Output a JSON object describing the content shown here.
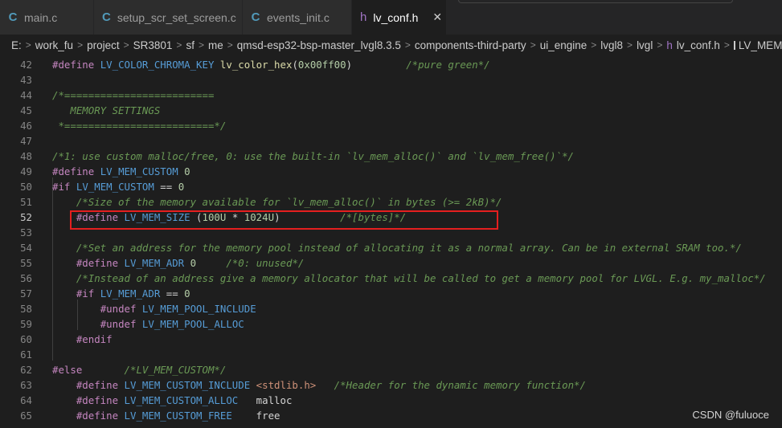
{
  "tabs": [
    {
      "icon": "C",
      "label": "main.c"
    },
    {
      "icon": "C",
      "label": "setup_scr_set_screen.c"
    },
    {
      "icon": "C",
      "label": "events_init.c"
    },
    {
      "icon": "h",
      "label": "lv_conf.h",
      "close": "✕"
    }
  ],
  "breadcrumb": [
    "E:",
    "work_fu",
    "project",
    "SR3801",
    "sf",
    "me",
    "qmsd-esp32-bsp-master_lvgl8.3.5",
    "components-third-party",
    "ui_engine",
    "lvgl8",
    "lvgl",
    "lv_conf.h",
    "LV_MEM_SIZE"
  ],
  "breadcrumb_file_icon": "h",
  "editor": {
    "current_line": "52",
    "lines": [
      {
        "n": "42",
        "t": [
          [
            "kw",
            "#define"
          ],
          [
            "pl",
            " "
          ],
          [
            "mac",
            "LV_COLOR_CHROMA_KEY"
          ],
          [
            "pl",
            " "
          ],
          [
            "fn",
            "lv_color_hex"
          ],
          [
            "pl",
            "("
          ],
          [
            "num",
            "0x00ff00"
          ],
          [
            "pl",
            ")         "
          ],
          [
            "cm",
            "/*pure green*/"
          ]
        ]
      },
      {
        "n": "43",
        "t": []
      },
      {
        "n": "44",
        "t": [
          [
            "cm",
            "/*========================="
          ]
        ]
      },
      {
        "n": "45",
        "t": [
          [
            "cm",
            "   MEMORY SETTINGS"
          ]
        ]
      },
      {
        "n": "46",
        "t": [
          [
            "cm",
            " *=========================*/"
          ]
        ]
      },
      {
        "n": "47",
        "t": []
      },
      {
        "n": "48",
        "t": [
          [
            "cm",
            "/*1: use custom malloc/free, 0: use the built-in `lv_mem_alloc()` and `lv_mem_free()`*/"
          ]
        ]
      },
      {
        "n": "49",
        "t": [
          [
            "kw",
            "#define"
          ],
          [
            "pl",
            " "
          ],
          [
            "mac",
            "LV_MEM_CUSTOM"
          ],
          [
            "pl",
            " "
          ],
          [
            "num",
            "0"
          ]
        ]
      },
      {
        "n": "50",
        "t": [
          [
            "kw",
            "#if"
          ],
          [
            "pl",
            " "
          ],
          [
            "mac",
            "LV_MEM_CUSTOM"
          ],
          [
            "pl",
            " == "
          ],
          [
            "num",
            "0"
          ]
        ]
      },
      {
        "n": "51",
        "t": [
          [
            "pl",
            "    "
          ],
          [
            "cm",
            "/*Size of the memory available for `lv_mem_alloc()` in bytes (>= 2kB)*/"
          ]
        ]
      },
      {
        "n": "52",
        "t": [
          [
            "pl",
            "    "
          ],
          [
            "kw",
            "#define"
          ],
          [
            "pl",
            " "
          ],
          [
            "mac",
            "LV_MEM_SIZE"
          ],
          [
            "pl",
            " ("
          ],
          [
            "num",
            "100U"
          ],
          [
            "pl",
            " * "
          ],
          [
            "num",
            "1024U"
          ],
          [
            "pl",
            ")          "
          ],
          [
            "cm",
            "/*[bytes]*/"
          ]
        ]
      },
      {
        "n": "53",
        "t": []
      },
      {
        "n": "54",
        "t": [
          [
            "pl",
            "    "
          ],
          [
            "cm",
            "/*Set an address for the memory pool instead of allocating it as a normal array. Can be in external SRAM too.*/"
          ]
        ]
      },
      {
        "n": "55",
        "t": [
          [
            "pl",
            "    "
          ],
          [
            "kw",
            "#define"
          ],
          [
            "pl",
            " "
          ],
          [
            "mac",
            "LV_MEM_ADR"
          ],
          [
            "pl",
            " "
          ],
          [
            "num",
            "0"
          ],
          [
            "pl",
            "     "
          ],
          [
            "cm",
            "/*0: unused*/"
          ]
        ]
      },
      {
        "n": "56",
        "t": [
          [
            "pl",
            "    "
          ],
          [
            "cm",
            "/*Instead of an address give a memory allocator that will be called to get a memory pool for LVGL. E.g. my_malloc*/"
          ]
        ]
      },
      {
        "n": "57",
        "t": [
          [
            "pl",
            "    "
          ],
          [
            "kw",
            "#if"
          ],
          [
            "pl",
            " "
          ],
          [
            "mac",
            "LV_MEM_ADR"
          ],
          [
            "pl",
            " == "
          ],
          [
            "num",
            "0"
          ]
        ]
      },
      {
        "n": "58",
        "t": [
          [
            "pl",
            "        "
          ],
          [
            "kw",
            "#undef"
          ],
          [
            "pl",
            " "
          ],
          [
            "mac",
            "LV_MEM_POOL_INCLUDE"
          ]
        ]
      },
      {
        "n": "59",
        "t": [
          [
            "pl",
            "        "
          ],
          [
            "kw",
            "#undef"
          ],
          [
            "pl",
            " "
          ],
          [
            "mac",
            "LV_MEM_POOL_ALLOC"
          ]
        ]
      },
      {
        "n": "60",
        "t": [
          [
            "pl",
            "    "
          ],
          [
            "kw",
            "#endif"
          ]
        ]
      },
      {
        "n": "61",
        "t": []
      },
      {
        "n": "62",
        "t": [
          [
            "kw",
            "#else"
          ],
          [
            "pl",
            "       "
          ],
          [
            "cm",
            "/*LV_MEM_CUSTOM*/"
          ]
        ]
      },
      {
        "n": "63",
        "t": [
          [
            "pl",
            "    "
          ],
          [
            "kw",
            "#define"
          ],
          [
            "pl",
            " "
          ],
          [
            "mac",
            "LV_MEM_CUSTOM_INCLUDE"
          ],
          [
            "pl",
            " "
          ],
          [
            "ang",
            "<stdlib.h>"
          ],
          [
            "pl",
            "   "
          ],
          [
            "cm",
            "/*Header for the dynamic memory function*/"
          ]
        ]
      },
      {
        "n": "64",
        "t": [
          [
            "pl",
            "    "
          ],
          [
            "kw",
            "#define"
          ],
          [
            "pl",
            " "
          ],
          [
            "mac",
            "LV_MEM_CUSTOM_ALLOC"
          ],
          [
            "pl",
            "   "
          ],
          [
            "pl",
            "malloc"
          ]
        ]
      },
      {
        "n": "65",
        "t": [
          [
            "pl",
            "    "
          ],
          [
            "kw",
            "#define"
          ],
          [
            "pl",
            " "
          ],
          [
            "mac",
            "LV_MEM_CUSTOM_FREE"
          ],
          [
            "pl",
            "    "
          ],
          [
            "pl",
            "free"
          ]
        ]
      }
    ]
  },
  "watermark": "CSDN @fuluoce",
  "colors": {
    "keyword": "#c586c0",
    "macro": "#569cd6",
    "number": "#b5cea8",
    "function": "#dcdcaa",
    "comment": "#6a9955",
    "highlight_box": "#e51f1f"
  }
}
